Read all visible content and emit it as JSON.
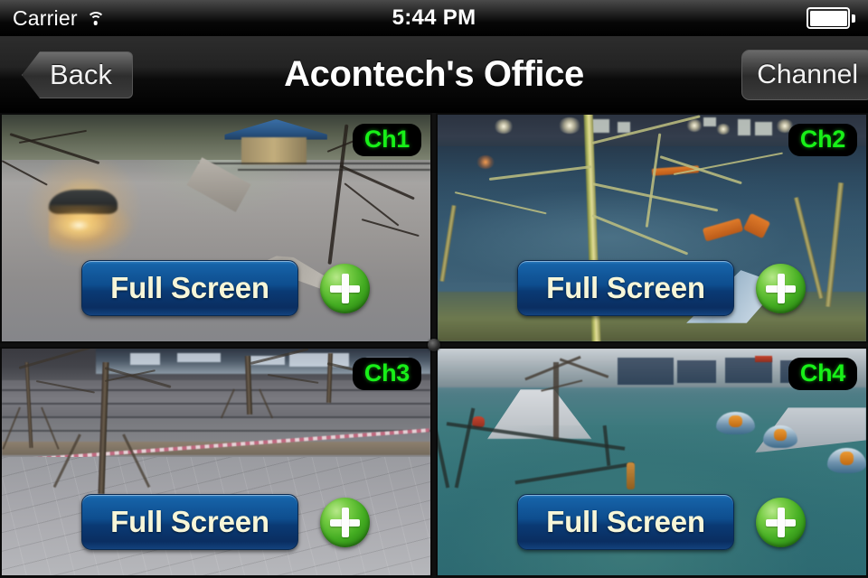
{
  "status_bar": {
    "carrier": "Carrier",
    "time": "5:44 PM",
    "wifi_icon": "wifi-icon",
    "battery_icon": "battery-full-icon"
  },
  "nav_bar": {
    "back_label": "Back",
    "title": "Acontech's Office",
    "channel_label": "Channel"
  },
  "grid": {
    "panes": [
      {
        "channel_label": "Ch1",
        "fullscreen_label": "Full Screen",
        "add_label": "+",
        "scene": "Evening parking plaza with car headlight glare, paved ground and bare tree branches"
      },
      {
        "channel_label": "Ch2",
        "fullscreen_label": "Full Screen",
        "add_label": "+",
        "scene": "Night playground with lit tree trunk, blue-teal ground and building lights"
      },
      {
        "channel_label": "Ch3",
        "fullscreen_label": "Full Screen",
        "add_label": "+",
        "scene": "Daytime paved street plaza with bare trees and support poles"
      },
      {
        "channel_label": "Ch4",
        "fullscreen_label": "Full Screen",
        "add_label": "+",
        "scene": "Daylight playground with teal rubber surface and orange spring riders"
      }
    ]
  },
  "colors": {
    "channel_badge_text": "#18f018",
    "channel_badge_bg": "#000000",
    "fullscreen_button_top": "#2f7fc4",
    "fullscreen_button_bottom": "#0a2e61",
    "fullscreen_text": "#f7f6d8",
    "add_button_green": "#44ad22",
    "status_bar_bg": "#000000",
    "nav_bar_bg": "#1a1a1a"
  }
}
